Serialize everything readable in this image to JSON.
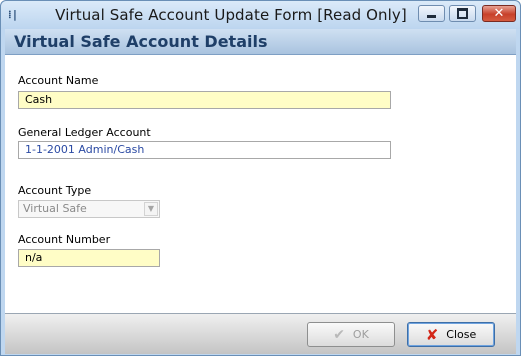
{
  "window": {
    "title": "Virtual Safe Account Update Form [Read Only]",
    "app_icon_glyph": "⁞|",
    "controls": {
      "minimize": "minimize-icon",
      "maximize": "restore-icon",
      "close": "close-icon"
    }
  },
  "header": {
    "title": "Virtual Safe Account Details"
  },
  "form": {
    "account_name": {
      "label": "Account Name",
      "value": "Cash"
    },
    "gl_account": {
      "label": "General Ledger Account",
      "value": "1-1-2001  Admin/Cash"
    },
    "account_type": {
      "label": "Account Type",
      "value": "Virtual Safe"
    },
    "account_number": {
      "label": "Account Number",
      "value": "n/a"
    }
  },
  "buttons": {
    "ok": {
      "label": "OK",
      "icon": "check-icon"
    },
    "close": {
      "label": "Close",
      "icon": "x-icon"
    }
  },
  "colors": {
    "header_text": "#1f3f68",
    "required_field_bg": "#fffdc6",
    "link_text": "#2b4aa3",
    "close_icon": "#d32718"
  }
}
